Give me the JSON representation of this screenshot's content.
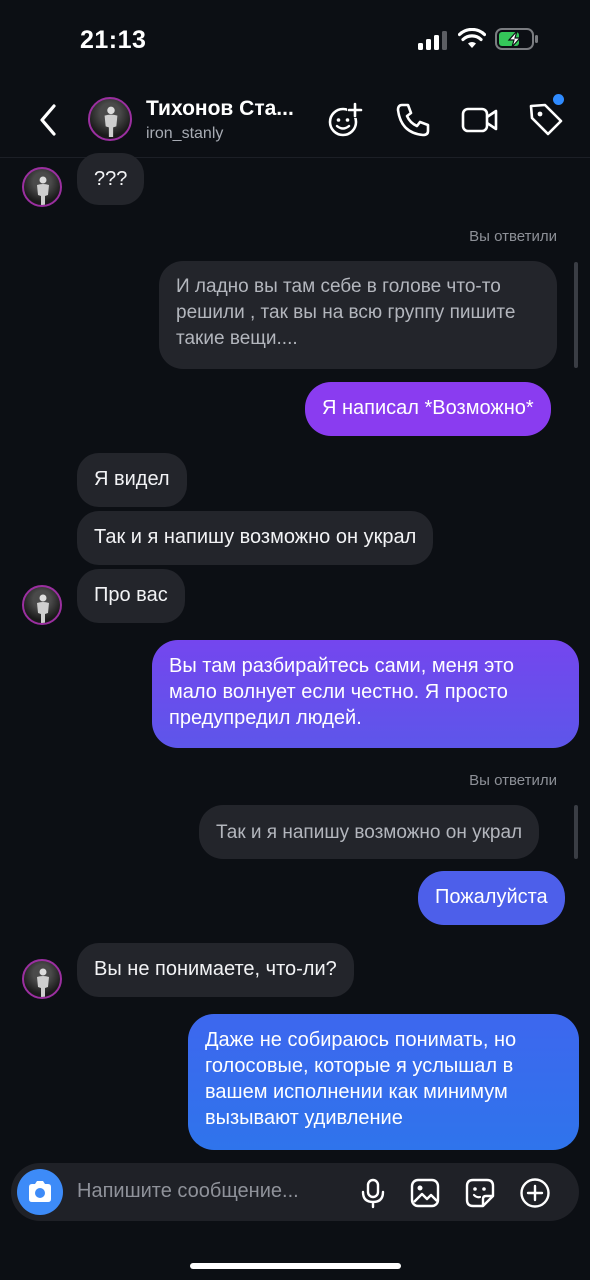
{
  "status_bar": {
    "time": "21:13"
  },
  "header": {
    "contact_name": "Тихонов Ста...",
    "username": "iron_stanly"
  },
  "colors": {
    "background": "#0c0f14",
    "incoming_bubble": "#23252b",
    "out_gradient_top": "#9b39f2",
    "out_gradient_bottom": "#2f74ec",
    "notification_dot": "#2f8bff",
    "camera_button": "#3d8bf8"
  },
  "icons": [
    "chevron-left-icon",
    "add-sticker-icon",
    "phone-icon",
    "video-camera-icon",
    "tag-icon",
    "camera-icon",
    "microphone-icon",
    "gallery-icon",
    "sticker-icon",
    "plus-circle-icon"
  ],
  "messages": [
    {
      "side": "in",
      "text": "???"
    },
    {
      "side": "label",
      "text": "Вы ответили"
    },
    {
      "side": "reply",
      "text": "И ладно вы там себе в голове что-то решили , так вы на всю группу пишите такие вещи...."
    },
    {
      "side": "out",
      "text": "Я написал *Возможно*"
    },
    {
      "side": "in",
      "text": "Я видел"
    },
    {
      "side": "in",
      "text": "Так и я напишу возможно он украл"
    },
    {
      "side": "in",
      "text": "Про вас"
    },
    {
      "side": "out",
      "text": "Вы там разбирайтесь сами, меня это мало волнует если честно. Я просто предупредил людей."
    },
    {
      "side": "label",
      "text": "Вы ответили"
    },
    {
      "side": "reply",
      "text": "Так и я напишу возможно он украл"
    },
    {
      "side": "out",
      "text": "Пожалуйста"
    },
    {
      "side": "in",
      "text": "Вы не понимаете, что-ли?"
    },
    {
      "side": "out",
      "text": "Даже не собираюсь понимать, но голосовые, которые я услышал в вашем исполнении как минимум вызывают удивление"
    }
  ],
  "composer": {
    "placeholder": "Напишите сообщение..."
  }
}
